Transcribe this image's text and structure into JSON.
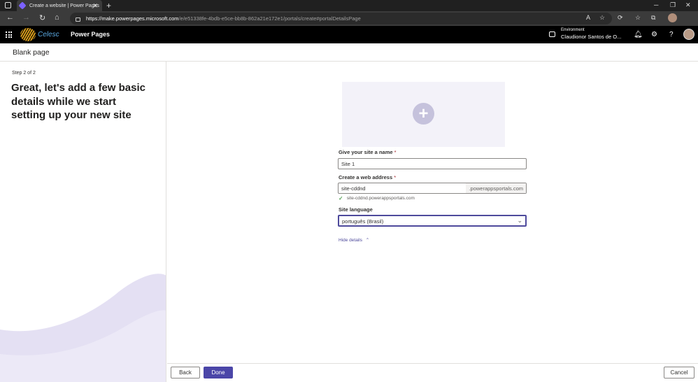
{
  "browser": {
    "tab_title": "Create a website | Power Pages",
    "url_host": "https://make.powerpages.microsoft.com",
    "url_path": "/e/e51338fe-4bdb-e5ce-bb8b-862a21e172e1/portals/create#portalDetailsPage"
  },
  "header": {
    "logo_text": "Celesc",
    "app_name": "Power Pages",
    "environment_label": "Environment",
    "environment_name": "Claudionor Santos de O..."
  },
  "page": {
    "title": "Blank page",
    "step": "Step 2 of 2",
    "headline": "Great, let's add a few basic details while we start setting up your new site"
  },
  "form": {
    "name_label": "Give your site a name",
    "name_value": "Site 1",
    "address_label": "Create a web address",
    "address_value": "site-cddnd",
    "address_suffix": ".powerappsportals.com",
    "address_valid_text": "site-cddnd.powerappsportals.com",
    "language_label": "Site language",
    "language_value": "português (Brasil)",
    "toggle_details": "Hide details",
    "required_mark": "*"
  },
  "footer": {
    "back": "Back",
    "done": "Done",
    "cancel": "Cancel"
  },
  "colors": {
    "accent": "#4b46a8",
    "wave": "#e4e0f3"
  }
}
